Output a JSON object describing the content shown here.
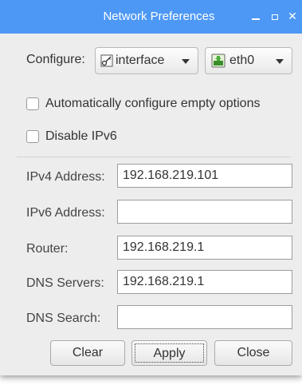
{
  "window": {
    "title": "Network Preferences"
  },
  "configure": {
    "label": "Configure:",
    "type_value": "interface",
    "interface_value": "eth0"
  },
  "options": {
    "auto_configure_label": "Automatically configure empty options",
    "auto_configure_checked": false,
    "disable_ipv6_label": "Disable IPv6",
    "disable_ipv6_checked": false
  },
  "fields": {
    "ipv4_label": "IPv4 Address:",
    "ipv4_value": "192.168.219.101",
    "ipv6_label": "IPv6 Address:",
    "ipv6_value": "",
    "router_label": "Router:",
    "router_value": "192.168.219.1",
    "dns_servers_label": "DNS Servers:",
    "dns_servers_value": "192.168.219.1",
    "dns_search_label": "DNS Search:",
    "dns_search_value": ""
  },
  "buttons": {
    "clear": "Clear",
    "apply": "Apply",
    "close": "Close"
  },
  "colors": {
    "titlebar": "#4d98f5",
    "background": "#ededed"
  }
}
